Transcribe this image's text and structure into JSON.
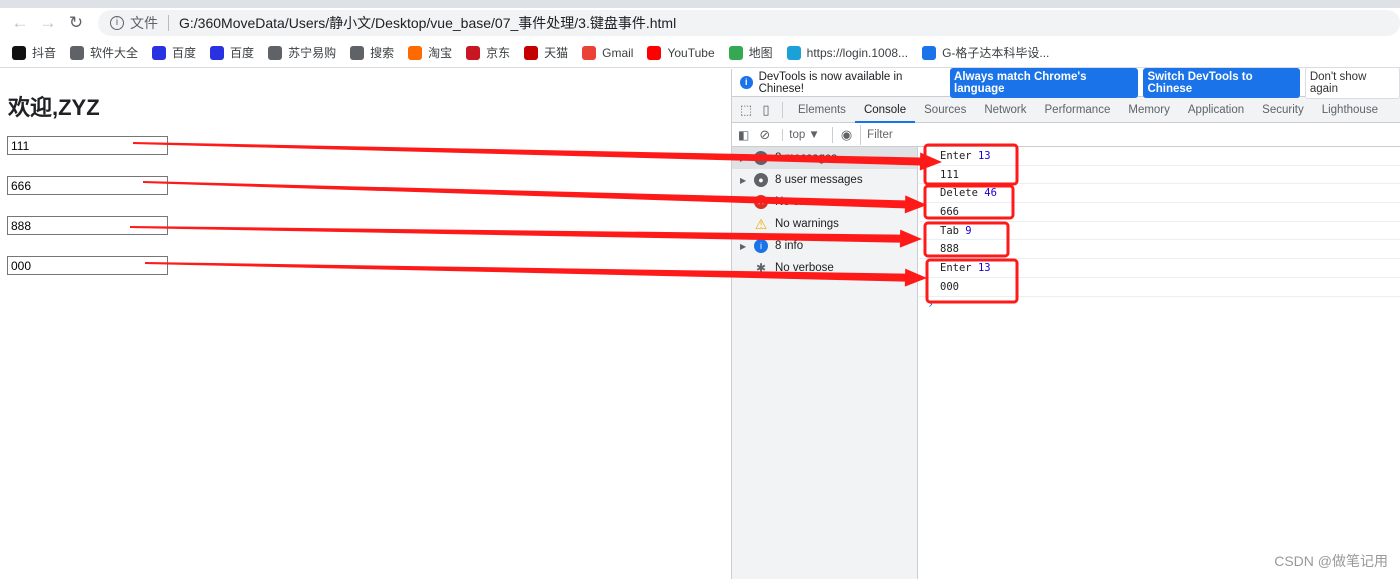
{
  "browser": {
    "address_prefix": "文件",
    "url": "G:/360MoveData/Users/静小文/Desktop/vue_base/07_事件处理/3.键盘事件.html",
    "bookmarks": [
      {
        "label": "抖音",
        "icon": "douyin-icon",
        "color": "#111111"
      },
      {
        "label": "软件大全",
        "icon": "globe-icon",
        "color": "#5f6368"
      },
      {
        "label": "百度",
        "icon": "baidu-paw-icon",
        "color": "#2932e1"
      },
      {
        "label": "百度",
        "icon": "baidu-paw-icon",
        "color": "#2932e1"
      },
      {
        "label": "苏宁易购",
        "icon": "globe-icon",
        "color": "#5f6368"
      },
      {
        "label": "搜索",
        "icon": "globe-icon",
        "color": "#5f6368"
      },
      {
        "label": "淘宝",
        "icon": "taobao-icon",
        "color": "#ff6a00"
      },
      {
        "label": "京东",
        "icon": "jd-icon",
        "color": "#c91623"
      },
      {
        "label": "天猫",
        "icon": "tmall-icon",
        "color": "#c40000"
      },
      {
        "label": "Gmail",
        "icon": "gmail-icon",
        "color": "#ea4335"
      },
      {
        "label": "YouTube",
        "icon": "youtube-icon",
        "color": "#ff0000"
      },
      {
        "label": "地图",
        "icon": "maps-icon",
        "color": "#34a853"
      },
      {
        "label": "https://login.1008...",
        "icon": "chinamobile-icon",
        "color": "#1ba0d8"
      },
      {
        "label": "G-格子达本科毕设...",
        "icon": "gezida-icon",
        "color": "#1a73e8"
      }
    ]
  },
  "page": {
    "heading": "欢迎,ZYZ",
    "inputs": [
      "111",
      "666",
      "888",
      "000"
    ]
  },
  "devtools": {
    "infobar": {
      "text": "DevTools is now available in Chinese!",
      "btn_match": "Always match Chrome's language",
      "btn_switch": "Switch DevTools to Chinese",
      "btn_dismiss": "Don't show again"
    },
    "tabs": [
      "Elements",
      "Console",
      "Sources",
      "Network",
      "Performance",
      "Memory",
      "Application",
      "Security",
      "Lighthouse"
    ],
    "active_tab": "Console",
    "context": "top ▼",
    "filter_placeholder": "Filter",
    "sidebar": [
      "8 messages",
      "8 user messages",
      "No errors",
      "No warnings",
      "8 info",
      "No verbose"
    ],
    "log": [
      {
        "key": "Enter",
        "code": "13",
        "value": "111"
      },
      {
        "key": "Delete",
        "code": "46",
        "value": "666"
      },
      {
        "key": "Tab",
        "code": "9",
        "value": "888"
      },
      {
        "key": "Enter",
        "code": "13",
        "value": "000"
      }
    ]
  },
  "annotation_color": "#ff1a1a",
  "watermark": "CSDN @做笔记用"
}
